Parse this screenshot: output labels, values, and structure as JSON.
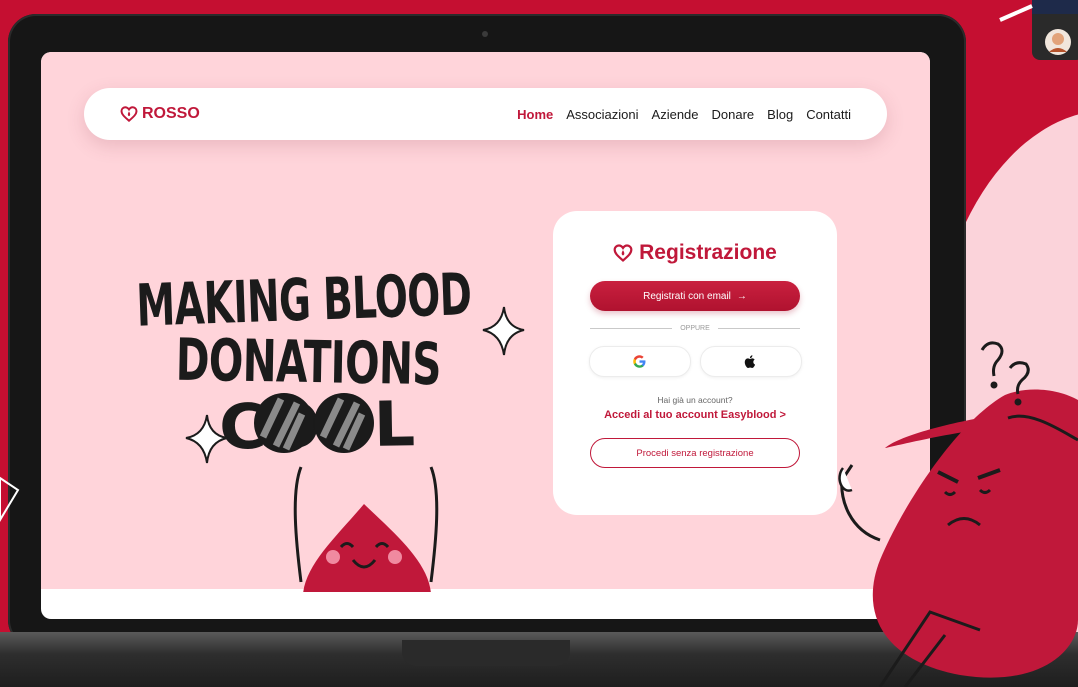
{
  "brand": {
    "name": "ROSSO",
    "color": "#c0183a"
  },
  "nav": {
    "links": [
      {
        "label": "Home",
        "active": true
      },
      {
        "label": "Associazioni"
      },
      {
        "label": "Aziende"
      },
      {
        "label": "Donare"
      },
      {
        "label": "Blog"
      },
      {
        "label": "Contatti"
      }
    ]
  },
  "hero": {
    "line1": "MAKING BLOOD",
    "line2": "DONATIONS",
    "line3": "COOL"
  },
  "signup": {
    "title": "Registrazione",
    "email_button": "Registrati con email",
    "email_button_icon": "arrow-right-icon",
    "divider": "OPPURE",
    "google_icon": "google-icon",
    "apple_icon": "apple-icon",
    "have_account": "Hai già un account?",
    "login_link": "Accedi al tuo account Easyblood >",
    "guest_button": "Procedi senza registrazione"
  },
  "colors": {
    "accent": "#c0183a",
    "page_bg": "#ffd4da",
    "desk_bg": "#c50f31"
  }
}
